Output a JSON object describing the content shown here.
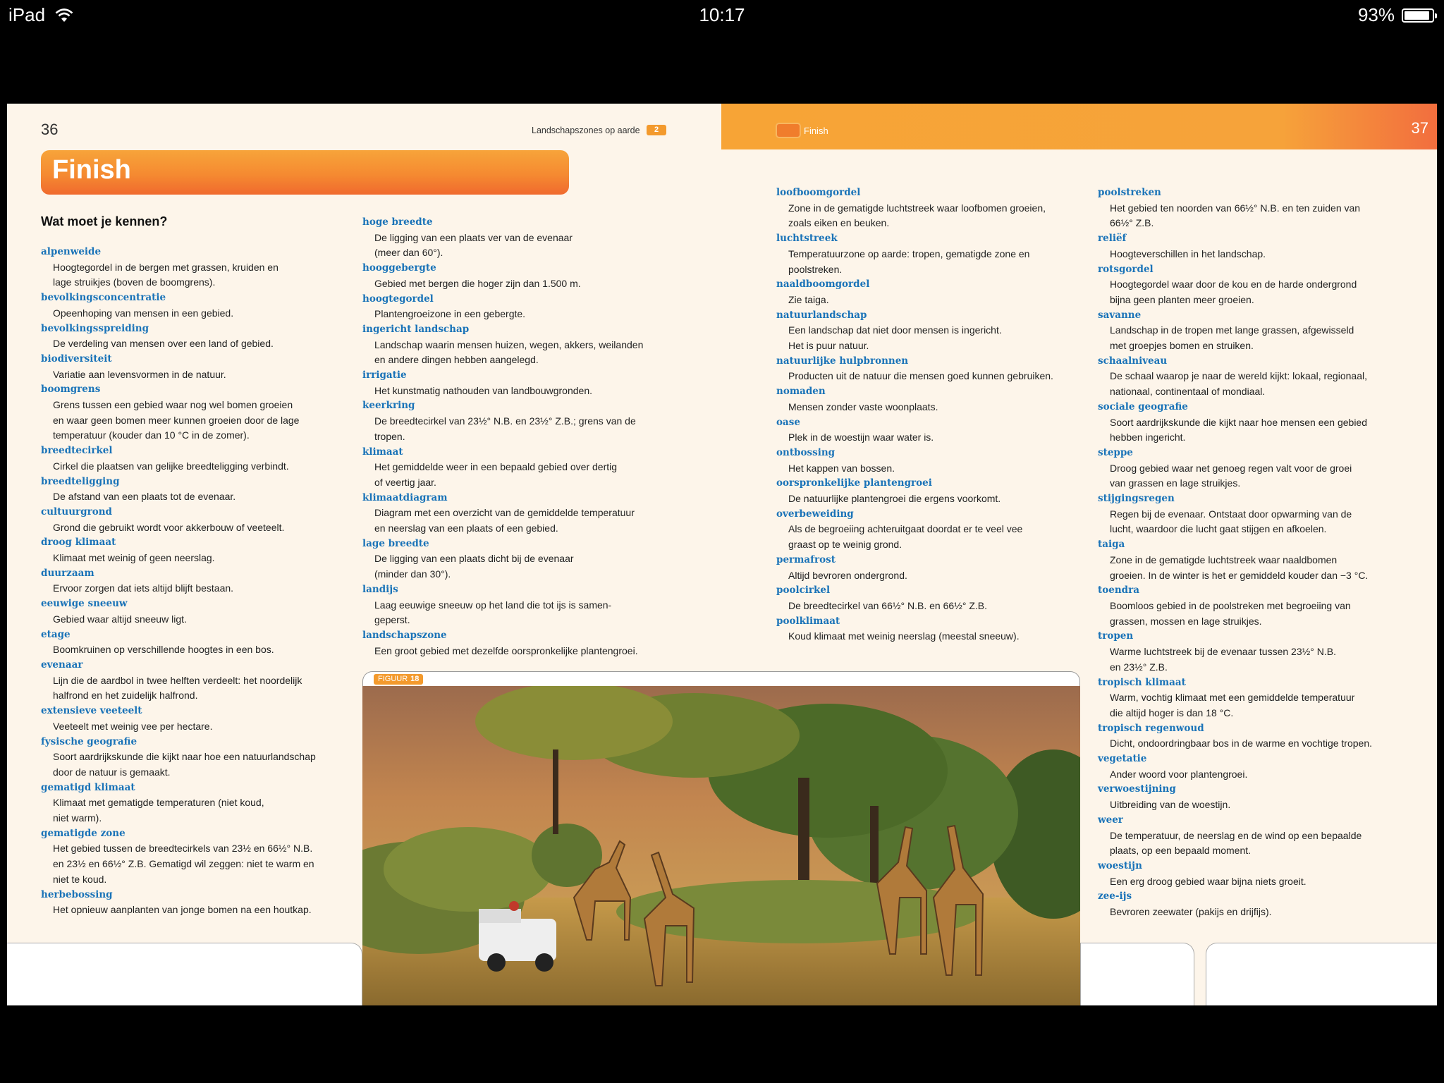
{
  "status_bar": {
    "device": "iPad",
    "time": "10:17",
    "battery": "93%",
    "battery_level": 0.93
  },
  "left_page": {
    "page_number": "36",
    "chapter_title": "Landschapszones op aarde",
    "chapter_number": "2",
    "banner_title": "Finish",
    "section_title": "Wat moet je kennen?"
  },
  "right_page": {
    "page_number": "37",
    "header_label": "Finish"
  },
  "figure": {
    "label": "FIGUUR",
    "number": "18"
  },
  "glossary": {
    "col1": [
      {
        "term": "alpenweide",
        "def": "Hoogtegordel in de bergen met grassen, kruiden en\nlage struikjes (boven de boomgrens)."
      },
      {
        "term": "bevolkingsconcentratie",
        "def": "Opeenhoping van mensen in een gebied."
      },
      {
        "term": "bevolkingsspreiding",
        "def": "De verdeling van mensen over een land of gebied."
      },
      {
        "term": "biodiversiteit",
        "def": "Variatie aan levensvormen in de natuur."
      },
      {
        "term": "boomgrens",
        "def": "Grens tussen een gebied waar nog wel bomen groeien\nen waar geen bomen meer kunnen groeien door de lage\ntemperatuur (kouder dan 10 °C in de zomer)."
      },
      {
        "term": "breedtecirkel",
        "def": "Cirkel die plaatsen van gelijke breedteligging verbindt."
      },
      {
        "term": "breedteligging",
        "def": "De afstand van een plaats tot de evenaar."
      },
      {
        "term": "cultuurgrond",
        "def": "Grond die gebruikt wordt voor akkerbouw of veeteelt."
      },
      {
        "term": "droog klimaat",
        "def": "Klimaat met weinig of geen neerslag."
      },
      {
        "term": "duurzaam",
        "def": "Ervoor zorgen dat iets altijd blijft bestaan."
      },
      {
        "term": "eeuwige sneeuw",
        "def": "Gebied waar altijd sneeuw ligt."
      },
      {
        "term": "etage",
        "def": "Boomkruinen op verschillende hoogtes in een bos."
      },
      {
        "term": "evenaar",
        "def": "Lijn die de aardbol in twee helften verdeelt: het noordelijk\nhalfrond en het zuidelijk halfrond."
      },
      {
        "term": "extensieve veeteelt",
        "def": "Veeteelt met weinig vee per hectare."
      },
      {
        "term": "fysische geografie",
        "def": "Soort aardrijkskunde die kijkt naar hoe een natuurlandschap\ndoor de natuur is gemaakt."
      },
      {
        "term": "gematigd klimaat",
        "def": "Klimaat met gematigde temperaturen (niet koud,\nniet warm)."
      },
      {
        "term": "gematigde zone",
        "def": "Het gebied tussen de breedtecirkels van 23½ en 66½° N.B.\nen 23½ en 66½° Z.B. Gematigd wil zeggen: niet te warm en\nniet te koud."
      },
      {
        "term": "herbebossing",
        "def": "Het opnieuw aanplanten van jonge bomen na een houtkap."
      }
    ],
    "col2": [
      {
        "term": "hoge breedte",
        "def": "De ligging van een plaats ver van de evenaar\n(meer dan 60°)."
      },
      {
        "term": "hooggebergte",
        "def": "Gebied met bergen die hoger zijn dan 1.500 m."
      },
      {
        "term": "hoogtegordel",
        "def": "Plantengroeizone in een gebergte."
      },
      {
        "term": "ingericht landschap",
        "def": "Landschap waarin mensen huizen, wegen, akkers, weilanden\nen andere dingen hebben aangelegd."
      },
      {
        "term": "irrigatie",
        "def": "Het kunstmatig nathouden van landbouwgronden."
      },
      {
        "term": "keerkring",
        "def": "De breedtecirkel van 23½° N.B. en 23½° Z.B.; grens van de\ntropen."
      },
      {
        "term": "klimaat",
        "def": "Het gemiddelde weer in een bepaald gebied over dertig\nof veertig jaar."
      },
      {
        "term": "klimaatdiagram",
        "def": "Diagram met een overzicht van de gemiddelde temperatuur\nen neerslag van een plaats of een gebied."
      },
      {
        "term": "lage breedte",
        "def": "De ligging van een plaats dicht bij de evenaar\n(minder dan 30°)."
      },
      {
        "term": "landijs",
        "def": "Laag eeuwige sneeuw op het land die tot ijs is samen-\ngeperst."
      },
      {
        "term": "landschapszone",
        "def": "Een groot gebied met dezelfde oorspronkelijke plantengroei."
      }
    ],
    "col3": [
      {
        "term": "loofboomgordel",
        "def": "Zone in de gematigde luchtstreek waar loofbomen groeien,\nzoals eiken en beuken."
      },
      {
        "term": "luchtstreek",
        "def": "Temperatuurzone op aarde: tropen, gematigde zone en\npoolstreken."
      },
      {
        "term": "naaldboomgordel",
        "def": "Zie taiga."
      },
      {
        "term": "natuurlandschap",
        "def": "Een landschap dat niet door mensen is ingericht.\nHet is puur natuur."
      },
      {
        "term": "natuurlijke hulpbronnen",
        "def": "Producten uit de natuur die mensen goed kunnen gebruiken."
      },
      {
        "term": "nomaden",
        "def": "Mensen zonder vaste woonplaats."
      },
      {
        "term": "oase",
        "def": "Plek in de woestijn waar water is."
      },
      {
        "term": "ontbossing",
        "def": "Het kappen van bossen."
      },
      {
        "term": "oorspronkelijke plantengroei",
        "def": "De natuurlijke plantengroei die ergens voorkomt."
      },
      {
        "term": "overbeweiding",
        "def": "Als de begroeiing achteruitgaat doordat er te veel vee\ngraast op te weinig grond."
      },
      {
        "term": "permafrost",
        "def": "Altijd bevroren ondergrond."
      },
      {
        "term": "poolcirkel",
        "def": "De breedtecirkel van 66½° N.B. en 66½° Z.B."
      },
      {
        "term": "poolklimaat",
        "def": "Koud klimaat met weinig neerslag (meestal sneeuw)."
      }
    ],
    "col4": [
      {
        "term": "poolstreken",
        "def": "Het gebied ten noorden van 66½° N.B. en ten zuiden van\n66½° Z.B."
      },
      {
        "term": "reliëf",
        "def": "Hoogteverschillen in het landschap."
      },
      {
        "term": "rotsgordel",
        "def": "Hoogtegordel waar door de kou en de harde ondergrond\nbijna geen planten meer groeien."
      },
      {
        "term": "savanne",
        "def": "Landschap in de tropen met lange grassen, afgewisseld\nmet groepjes bomen en struiken."
      },
      {
        "term": "schaalniveau",
        "def": "De schaal waarop je naar de wereld kijkt: lokaal, regionaal,\nnationaal, continentaal of mondiaal."
      },
      {
        "term": "sociale geografie",
        "def": "Soort aardrijkskunde die kijkt naar hoe mensen een gebied\nhebben ingericht."
      },
      {
        "term": "steppe",
        "def": "Droog gebied waar net genoeg regen valt voor de groei\nvan grassen en lage struikjes."
      },
      {
        "term": "stijgingsregen",
        "def": "Regen bij de evenaar. Ontstaat door opwarming van de\nlucht, waardoor die lucht gaat stijgen en afkoelen."
      },
      {
        "term": "taiga",
        "def": "Zone in de gematigde luchtstreek waar naaldbomen\ngroeien. In de winter is het er gemiddeld kouder dan −3 °C."
      },
      {
        "term": "toendra",
        "def": "Boomloos gebied in de poolstreken met begroeiing van\ngrassen, mossen en lage struikjes."
      },
      {
        "term": "tropen",
        "def": "Warme luchtstreek bij de evenaar tussen 23½° N.B.\nen 23½° Z.B."
      },
      {
        "term": "tropisch klimaat",
        "def": "Warm, vochtig klimaat met een gemiddelde temperatuur\ndie altijd hoger is dan 18 °C."
      },
      {
        "term": "tropisch regenwoud",
        "def": "Dicht, ondoordringbaar bos in de warme en vochtige tropen."
      },
      {
        "term": "vegetatie",
        "def": "Ander woord voor plantengroei."
      },
      {
        "term": "verwoestijning",
        "def": "Uitbreiding van de woestijn."
      },
      {
        "term": "weer",
        "def": "De temperatuur, de neerslag en de wind op een bepaalde\nplaats, op een bepaald moment."
      },
      {
        "term": "woestijn",
        "def": "Een erg droog gebied waar bijna niets groeit."
      },
      {
        "term": "zee-ijs",
        "def": "Bevroren zeewater (pakijs en drijfijs)."
      }
    ]
  }
}
